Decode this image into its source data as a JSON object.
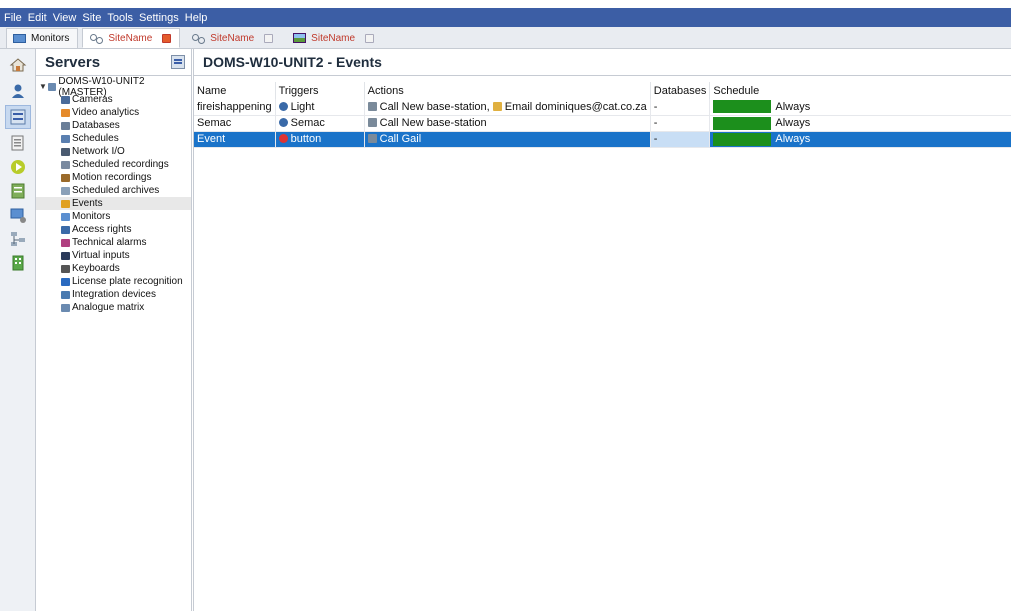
{
  "menubar": [
    "File",
    "Edit",
    "View",
    "Site",
    "Tools",
    "Settings",
    "Help"
  ],
  "tabs": [
    {
      "label": "Monitors",
      "icon": "monitor-icon"
    },
    {
      "label": "SiteName",
      "icon": "site-icon"
    },
    {
      "label": "SiteName",
      "icon": "site-icon"
    },
    {
      "label": "SiteName",
      "icon": "image-icon"
    }
  ],
  "servers": {
    "title": "Servers",
    "root": "DOMS-W10-UNIT2 (MASTER)",
    "items": [
      {
        "label": "Cameras",
        "color": "#4a6b9a"
      },
      {
        "label": "Video analytics",
        "color": "#e58a2a"
      },
      {
        "label": "Databases",
        "color": "#6a7e98"
      },
      {
        "label": "Schedules",
        "color": "#5a7fb0"
      },
      {
        "label": "Network I/O",
        "color": "#4a5a70"
      },
      {
        "label": "Scheduled recordings",
        "color": "#7a8aa0"
      },
      {
        "label": "Motion recordings",
        "color": "#9a6a2a"
      },
      {
        "label": "Scheduled archives",
        "color": "#8aa0b8"
      },
      {
        "label": "Events",
        "color": "#e0a020"
      },
      {
        "label": "Monitors",
        "color": "#5b8fd0"
      },
      {
        "label": "Access rights",
        "color": "#3a6aa8"
      },
      {
        "label": "Technical alarms",
        "color": "#b04080"
      },
      {
        "label": "Virtual inputs",
        "color": "#2a3a5a"
      },
      {
        "label": "Keyboards",
        "color": "#555555"
      },
      {
        "label": "License plate recognition",
        "color": "#2a6ac0"
      },
      {
        "label": "Integration devices",
        "color": "#4a7ab0"
      },
      {
        "label": "Analogue matrix",
        "color": "#6a8ab0"
      }
    ],
    "selected_index": 8
  },
  "main": {
    "title": "DOMS-W10-UNIT2 - Events",
    "columns": [
      "Name",
      "Triggers",
      "Actions",
      "Databases",
      "Schedule"
    ],
    "rows": [
      {
        "name": "fireishappening",
        "trigger": "Light",
        "actions": "Call New base-station,",
        "actions_extra": "Email dominiques@cat.co.za",
        "databases": "-",
        "schedule": "Always",
        "selected": false
      },
      {
        "name": "Semac",
        "trigger": "Semac",
        "actions": "Call New base-station",
        "actions_extra": "",
        "databases": "-",
        "schedule": "Always",
        "selected": false
      },
      {
        "name": "Event",
        "trigger": "button",
        "actions": "Call Gail",
        "actions_extra": "",
        "databases": "-",
        "schedule": "Always",
        "selected": true
      }
    ]
  },
  "colors": {
    "accent": "#3c5ea5",
    "selection": "#1a73c9",
    "schedule": "#1c8f1c"
  }
}
